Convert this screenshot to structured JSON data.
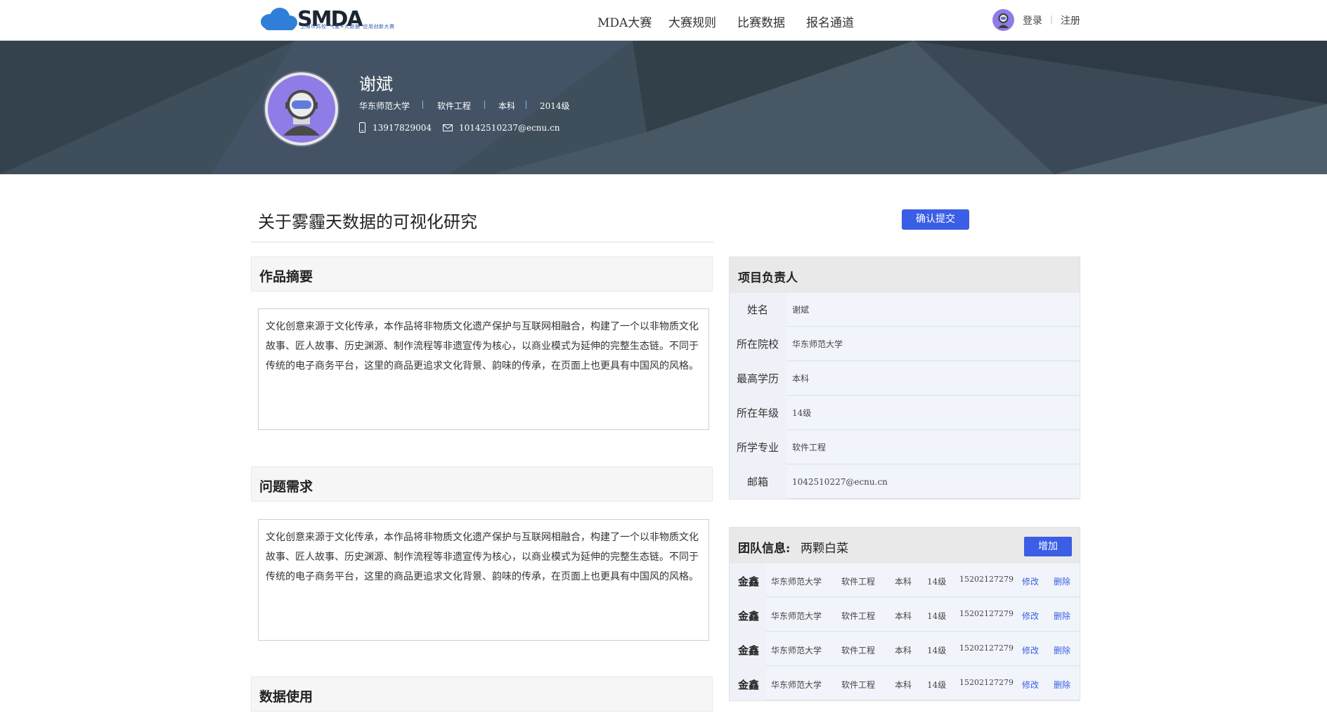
{
  "logo": {
    "text": "SMDA",
    "subtitle": "上海市高校“气象+大数据”应用创新大赛"
  },
  "nav": {
    "items": [
      "MDA大赛",
      "大赛规则",
      "比赛数据",
      "报名通道"
    ]
  },
  "auth": {
    "login": "登录",
    "separator": "|",
    "register": "注册"
  },
  "profile": {
    "name": "谢斌",
    "school": "华东师范大学",
    "major": "软件工程",
    "degree": "本科",
    "grade": "2014级",
    "phone": "13917829004",
    "email": "10142510237@ecnu.cn"
  },
  "project": {
    "title": "关于雾霾天数据的可视化研究"
  },
  "confirm_button": "确认提交",
  "sections": [
    {
      "title": "作品摘要",
      "text": "文化创意来源于文化传承，本作品将非物质文化遗产保护与互联网相融合，构建了一个以非物质文化故事、匠人故事、历史渊源、制作流程等非遗宣传为核心，以商业模式为延伸的完整生态链。不同于传统的电子商务平台，这里的商品更追求文化背景、韵味的传承，在页面上也更具有中国风的风格。"
    },
    {
      "title": "问题需求",
      "text": "文化创意来源于文化传承，本作品将非物质文化遗产保护与互联网相融合，构建了一个以非物质文化故事、匠人故事、历史渊源、制作流程等非遗宣传为核心，以商业模式为延伸的完整生态链。不同于传统的电子商务平台，这里的商品更追求文化背景、韵味的传承，在页面上也更具有中国风的风格。"
    },
    {
      "title": "数据使用",
      "text": ""
    }
  ],
  "leader": {
    "title": "项目负责人",
    "rows": [
      {
        "label": "姓名",
        "value": "谢斌"
      },
      {
        "label": "所在院校",
        "value": "华东师范大学"
      },
      {
        "label": "最高学历",
        "value": "本科"
      },
      {
        "label": "所在年级",
        "value": "14级"
      },
      {
        "label": "所学专业",
        "value": "软件工程"
      },
      {
        "label": "邮箱",
        "value": "1042510227@ecnu.cn"
      }
    ]
  },
  "team": {
    "label": "团队信息:",
    "name": "两颗白菜",
    "add_button": "增加",
    "members": [
      {
        "name": "金鑫",
        "school": "华东师范大学",
        "major": "软件工程",
        "degree": "本科",
        "grade": "14级",
        "phone": "15202127279",
        "edit": "修改",
        "delete": "删除"
      },
      {
        "name": "金鑫",
        "school": "华东师范大学",
        "major": "软件工程",
        "degree": "本科",
        "grade": "14级",
        "phone": "15202127279",
        "edit": "修改",
        "delete": "删除"
      },
      {
        "name": "金鑫",
        "school": "华东师范大学",
        "major": "软件工程",
        "degree": "本科",
        "grade": "14级",
        "phone": "15202127279",
        "edit": "修改",
        "delete": "删除"
      },
      {
        "name": "金鑫",
        "school": "华东师范大学",
        "major": "软件工程",
        "degree": "本科",
        "grade": "14级",
        "phone": "15202127279",
        "edit": "修改",
        "delete": "删除"
      }
    ]
  },
  "colors": {
    "accent": "#3b5ee6",
    "avatar_bg": "#8f7ce6",
    "banner": "#3b4a57"
  },
  "icons": {
    "avatar": "astronaut-avatar-icon",
    "phone": "phone-icon",
    "email": "envelope-icon",
    "logo": "cloud-logo-icon"
  }
}
